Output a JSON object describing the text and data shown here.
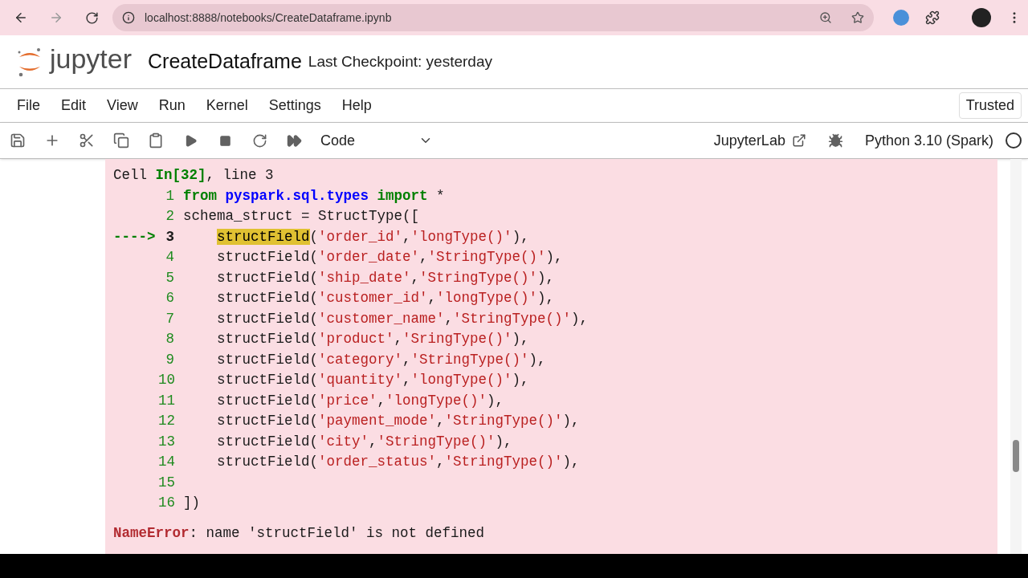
{
  "browser": {
    "url": "localhost:8888/notebooks/CreateDataframe.ipynb"
  },
  "header": {
    "logo_text": "jupyter",
    "notebook_name": "CreateDataframe",
    "checkpoint": "Last Checkpoint: yesterday",
    "trust": "Trusted"
  },
  "menu": [
    "File",
    "Edit",
    "View",
    "Run",
    "Kernel",
    "Settings",
    "Help"
  ],
  "toolbar": {
    "cell_type": "Code",
    "link": "JupyterLab",
    "kernel": "Python 3.10 (Spark)"
  },
  "output": {
    "header": [
      {
        "kind": "plain",
        "text": "Cell "
      },
      {
        "kind": "keyword",
        "text": "In[32]"
      },
      {
        "kind": "plain",
        "text": ", line 3"
      }
    ],
    "lines": [
      {
        "number": "1",
        "current": false,
        "indent": false,
        "segments": [
          {
            "kind": "keyword",
            "text": "from"
          },
          {
            "kind": "module",
            "text": " pyspark.sql.types"
          },
          {
            "kind": "keyword",
            "text": " import"
          },
          {
            "kind": "plain",
            "text": " *"
          }
        ]
      },
      {
        "number": "2",
        "current": false,
        "indent": false,
        "segments": [
          {
            "kind": "plain",
            "text": "schema_struct = StructType(["
          }
        ]
      },
      {
        "number": "3",
        "arrow": "---->",
        "current": true,
        "indent": true,
        "segments": [
          {
            "kind": "highlight",
            "text": "structField"
          },
          {
            "kind": "plain",
            "text": "("
          },
          {
            "kind": "string",
            "text": "'order_id'"
          },
          {
            "kind": "plain",
            "text": ","
          },
          {
            "kind": "string",
            "text": "'longType()'"
          },
          {
            "kind": "plain",
            "text": "),"
          }
        ]
      },
      {
        "number": "4",
        "current": false,
        "indent": true,
        "segments": [
          {
            "kind": "plain",
            "text": "structField("
          },
          {
            "kind": "string",
            "text": "'order_date'"
          },
          {
            "kind": "plain",
            "text": ","
          },
          {
            "kind": "string",
            "text": "'StringType()'"
          },
          {
            "kind": "plain",
            "text": "),"
          }
        ]
      },
      {
        "number": "5",
        "current": false,
        "indent": true,
        "segments": [
          {
            "kind": "plain",
            "text": "structField("
          },
          {
            "kind": "string",
            "text": "'ship_date'"
          },
          {
            "kind": "plain",
            "text": ","
          },
          {
            "kind": "string",
            "text": "'StringType()'"
          },
          {
            "kind": "plain",
            "text": "),"
          }
        ]
      },
      {
        "number": "6",
        "current": false,
        "indent": true,
        "segments": [
          {
            "kind": "plain",
            "text": "structField("
          },
          {
            "kind": "string",
            "text": "'customer_id'"
          },
          {
            "kind": "plain",
            "text": ","
          },
          {
            "kind": "string",
            "text": "'longType()'"
          },
          {
            "kind": "plain",
            "text": "),"
          }
        ]
      },
      {
        "number": "7",
        "current": false,
        "indent": true,
        "segments": [
          {
            "kind": "plain",
            "text": "structField("
          },
          {
            "kind": "string",
            "text": "'customer_name'"
          },
          {
            "kind": "plain",
            "text": ","
          },
          {
            "kind": "string",
            "text": "'StringType()'"
          },
          {
            "kind": "plain",
            "text": "),"
          }
        ]
      },
      {
        "number": "8",
        "current": false,
        "indent": true,
        "segments": [
          {
            "kind": "plain",
            "text": "structField("
          },
          {
            "kind": "string",
            "text": "'product'"
          },
          {
            "kind": "plain",
            "text": ","
          },
          {
            "kind": "string",
            "text": "'SringType()'"
          },
          {
            "kind": "plain",
            "text": "),"
          }
        ]
      },
      {
        "number": "9",
        "current": false,
        "indent": true,
        "segments": [
          {
            "kind": "plain",
            "text": "structField("
          },
          {
            "kind": "string",
            "text": "'category'"
          },
          {
            "kind": "plain",
            "text": ","
          },
          {
            "kind": "string",
            "text": "'StringType()'"
          },
          {
            "kind": "plain",
            "text": "),"
          }
        ]
      },
      {
        "number": "10",
        "current": false,
        "indent": true,
        "segments": [
          {
            "kind": "plain",
            "text": "structField("
          },
          {
            "kind": "string",
            "text": "'quantity'"
          },
          {
            "kind": "plain",
            "text": ","
          },
          {
            "kind": "string",
            "text": "'longType()'"
          },
          {
            "kind": "plain",
            "text": "),"
          }
        ]
      },
      {
        "number": "11",
        "current": false,
        "indent": true,
        "segments": [
          {
            "kind": "plain",
            "text": "structField("
          },
          {
            "kind": "string",
            "text": "'price'"
          },
          {
            "kind": "plain",
            "text": ","
          },
          {
            "kind": "string",
            "text": "'longType()'"
          },
          {
            "kind": "plain",
            "text": "),"
          }
        ]
      },
      {
        "number": "12",
        "current": false,
        "indent": true,
        "segments": [
          {
            "kind": "plain",
            "text": "structField("
          },
          {
            "kind": "string",
            "text": "'payment_mode'"
          },
          {
            "kind": "plain",
            "text": ","
          },
          {
            "kind": "string",
            "text": "'StringType()'"
          },
          {
            "kind": "plain",
            "text": "),"
          }
        ]
      },
      {
        "number": "13",
        "current": false,
        "indent": true,
        "segments": [
          {
            "kind": "plain",
            "text": "structField("
          },
          {
            "kind": "string",
            "text": "'city'"
          },
          {
            "kind": "plain",
            "text": ","
          },
          {
            "kind": "string",
            "text": "'StringType()'"
          },
          {
            "kind": "plain",
            "text": "),"
          }
        ]
      },
      {
        "number": "14",
        "current": false,
        "indent": true,
        "segments": [
          {
            "kind": "plain",
            "text": "structField("
          },
          {
            "kind": "string",
            "text": "'order_status'"
          },
          {
            "kind": "plain",
            "text": ","
          },
          {
            "kind": "string",
            "text": "'StringType()'"
          },
          {
            "kind": "plain",
            "text": "),"
          }
        ]
      },
      {
        "number": "15",
        "current": false
      },
      {
        "number": "16",
        "current": false,
        "indent": false,
        "segments": [
          {
            "kind": "plain",
            "text": "])"
          }
        ]
      }
    ],
    "error": [
      {
        "kind": "error",
        "text": "NameError"
      },
      {
        "kind": "plain",
        "text": ": name 'structField' is not defined"
      }
    ]
  }
}
